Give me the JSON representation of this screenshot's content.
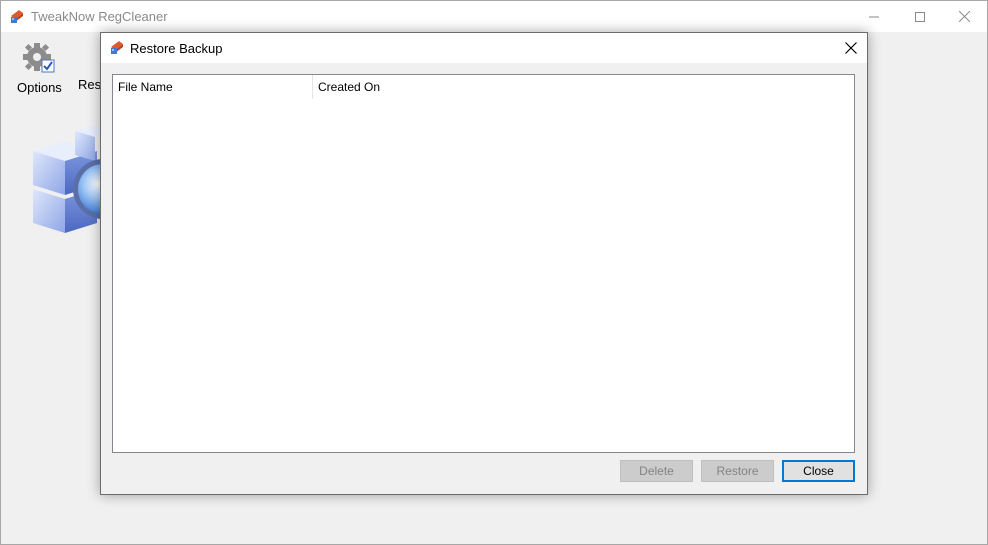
{
  "main_window": {
    "title": "TweakNow RegCleaner",
    "toolbar": [
      {
        "label": "Options",
        "icon": "gear-checkbox-icon"
      },
      {
        "label": "Resto",
        "icon": "restore-icon"
      }
    ]
  },
  "dialog": {
    "title": "Restore Backup",
    "columns": [
      "File Name",
      "Created On"
    ],
    "rows": [],
    "buttons": {
      "delete": "Delete",
      "restore": "Restore",
      "close": "Close"
    }
  },
  "colors": {
    "accent": "#0078d7",
    "disabled_button": "#cccccc",
    "disabled_text": "#838383"
  }
}
